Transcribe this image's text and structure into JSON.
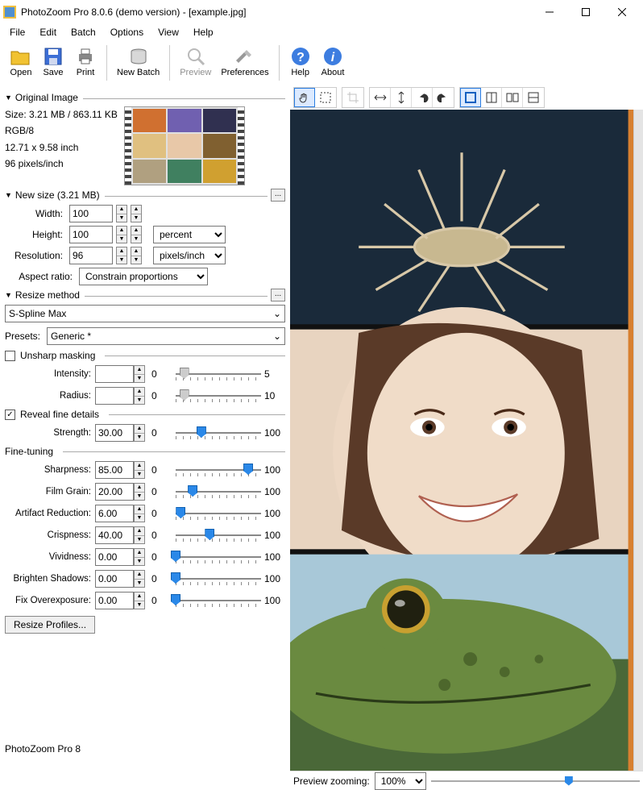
{
  "window": {
    "title": "PhotoZoom Pro 8.0.6 (demo version) - [example.jpg]"
  },
  "menu": [
    "File",
    "Edit",
    "Batch",
    "Options",
    "View",
    "Help"
  ],
  "toolbar": {
    "open": "Open",
    "save": "Save",
    "print": "Print",
    "newbatch": "New Batch",
    "preview": "Preview",
    "preferences": "Preferences",
    "help": "Help",
    "about": "About"
  },
  "original": {
    "header": "Original Image",
    "size": "Size: 3.21 MB / 863.11 KB",
    "mode": "RGB/8",
    "dims": "12.71 x 9.58 inch",
    "res": "96 pixels/inch"
  },
  "newsize": {
    "header": "New size (3.21 MB)",
    "width_label": "Width:",
    "width": "100",
    "height_label": "Height:",
    "height": "100",
    "unit": "percent",
    "res_label": "Resolution:",
    "res": "96",
    "res_unit": "pixels/inch",
    "aspect_label": "Aspect ratio:",
    "aspect": "Constrain proportions"
  },
  "resize": {
    "header": "Resize method",
    "method": "S-Spline Max",
    "presets_label": "Presets:",
    "preset": "Generic *",
    "unsharp_label": "Unsharp masking",
    "unsharp_checked": false,
    "intensity_label": "Intensity:",
    "intensity": "",
    "intensity_min": "0",
    "intensity_max": "5",
    "radius_label": "Radius:",
    "radius": "",
    "radius_min": "0",
    "radius_max": "10",
    "reveal_label": "Reveal fine details",
    "reveal_checked": true,
    "strength_label": "Strength:",
    "strength": "30.00",
    "finetune_header": "Fine-tuning",
    "sliders": [
      {
        "label": "Sharpness:",
        "value": "85.00",
        "min": "0",
        "max": "100",
        "pos": 85
      },
      {
        "label": "Film Grain:",
        "value": "20.00",
        "min": "0",
        "max": "100",
        "pos": 20
      },
      {
        "label": "Artifact Reduction:",
        "value": "6.00",
        "min": "0",
        "max": "100",
        "pos": 6
      },
      {
        "label": "Crispness:",
        "value": "40.00",
        "min": "0",
        "max": "100",
        "pos": 40
      },
      {
        "label": "Vividness:",
        "value": "0.00",
        "min": "0",
        "max": "100",
        "pos": 0
      },
      {
        "label": "Brighten Shadows:",
        "value": "0.00",
        "min": "0",
        "max": "100",
        "pos": 0
      },
      {
        "label": "Fix Overexposure:",
        "value": "0.00",
        "min": "0",
        "max": "100",
        "pos": 0
      }
    ],
    "profiles_btn": "Resize Profiles..."
  },
  "previewzoom": {
    "label": "Preview zooming:",
    "value": "100%"
  },
  "status": "PhotoZoom Pro 8"
}
